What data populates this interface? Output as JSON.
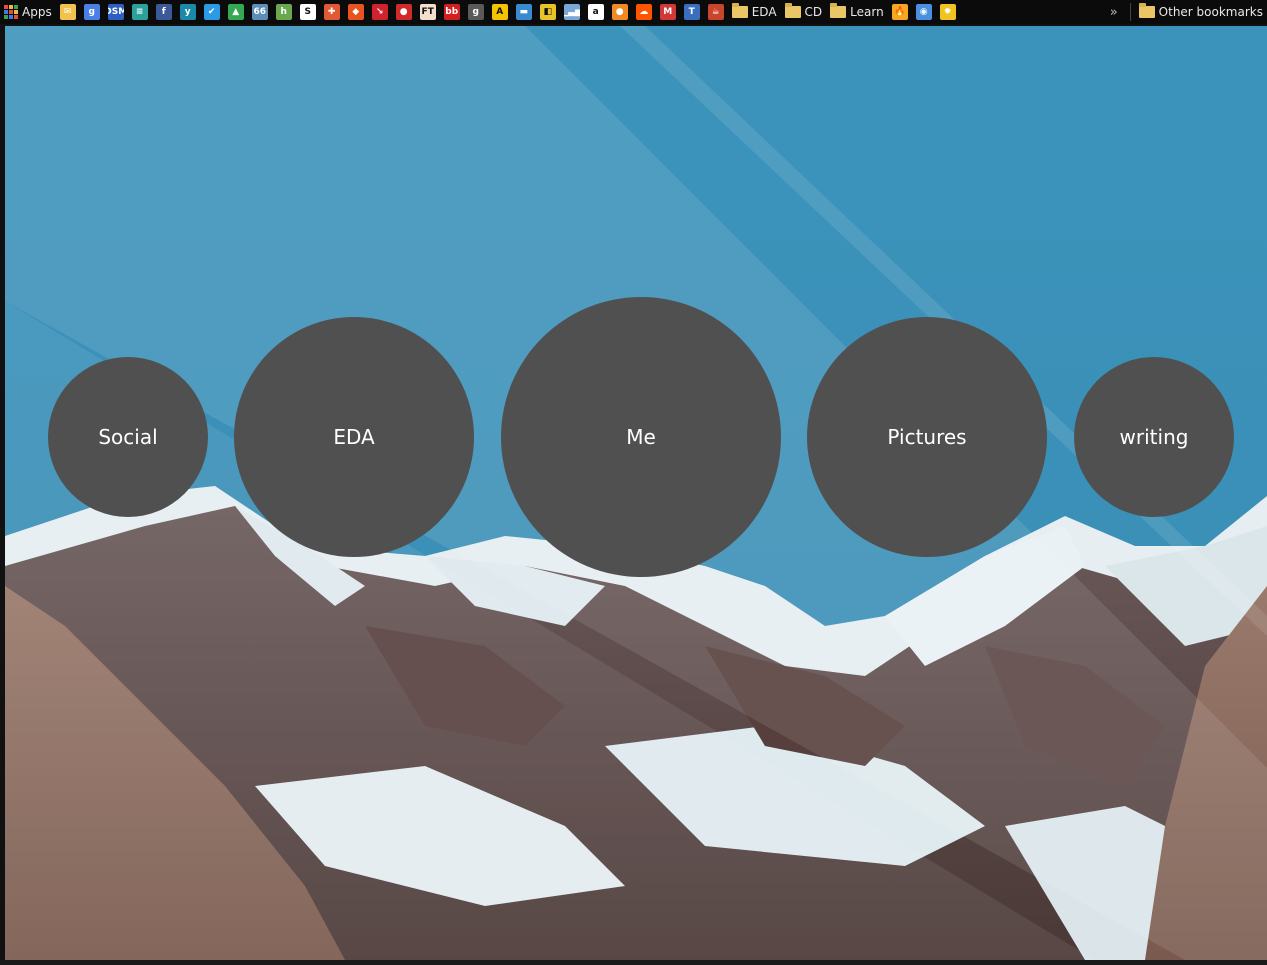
{
  "bookmarks_bar": {
    "apps_label": "Apps",
    "icons": [
      {
        "name": "checkmail-icon",
        "color": "#f1c24d",
        "glyph": "✉"
      },
      {
        "name": "google-icon",
        "color": "#4a7fe8",
        "glyph": "g"
      },
      {
        "name": "dsm-icon",
        "color": "#2f5fc0",
        "glyph": "DSM"
      },
      {
        "name": "translate-icon",
        "color": "#2aa29a",
        "glyph": "≡"
      },
      {
        "name": "facebook-icon",
        "color": "#3b5998",
        "glyph": "f"
      },
      {
        "name": "yc-icon",
        "color": "#1a8aa8",
        "glyph": "y"
      },
      {
        "name": "check-circle-icon",
        "color": "#2b9be8",
        "glyph": "✔"
      },
      {
        "name": "google-drive-icon",
        "color": "#34a853",
        "glyph": "▲"
      },
      {
        "name": "sixty-six-icon",
        "color": "#5b8fb8",
        "glyph": "66"
      },
      {
        "name": "h-icon",
        "color": "#6aa84f",
        "glyph": "h"
      },
      {
        "name": "s-icon",
        "color": "#ffffff",
        "glyph": "S"
      },
      {
        "name": "figure-icon",
        "color": "#e05a36",
        "glyph": "✚"
      },
      {
        "name": "layers-icon",
        "color": "#e8531f",
        "glyph": "◆"
      },
      {
        "name": "arrow-icon",
        "color": "#d0232e",
        "glyph": "↘"
      },
      {
        "name": "red-dot-icon",
        "color": "#d02a2a",
        "glyph": "●"
      },
      {
        "name": "ft-icon",
        "color": "#f2dfce",
        "glyph": "FT"
      },
      {
        "name": "bb-icon",
        "color": "#d21f1f",
        "glyph": "bb"
      },
      {
        "name": "goodreads-icon",
        "color": "#5a5a5a",
        "glyph": "g"
      },
      {
        "name": "a-icon",
        "color": "#f4c400",
        "glyph": "A"
      },
      {
        "name": "bars-icon",
        "color": "#3a8ad0",
        "glyph": "▬"
      },
      {
        "name": "flag-icon",
        "color": "#e8c42a",
        "glyph": "◧"
      },
      {
        "name": "signal-icon",
        "color": "#7aa7d8",
        "glyph": "▁▃▅"
      },
      {
        "name": "amazon-icon",
        "color": "#ffffff",
        "glyph": "a"
      },
      {
        "name": "orange-circle-icon",
        "color": "#f08a24",
        "glyph": "●"
      },
      {
        "name": "soundcloud-icon",
        "color": "#ff5500",
        "glyph": "☁"
      },
      {
        "name": "m-icon",
        "color": "#d23838",
        "glyph": "M"
      },
      {
        "name": "t-icon",
        "color": "#3a6fc0",
        "glyph": "T"
      },
      {
        "name": "coffee-icon",
        "color": "#c8442a",
        "glyph": "☕"
      }
    ],
    "folders": [
      {
        "name": "folder-eda",
        "label": "EDA"
      },
      {
        "name": "folder-cd",
        "label": "CD"
      },
      {
        "name": "folder-learn",
        "label": "Learn"
      }
    ],
    "tail_icons": [
      {
        "name": "flame-icon",
        "color": "#f5a623",
        "glyph": "🔥"
      },
      {
        "name": "globe-icon",
        "color": "#4a90e2",
        "glyph": "◉"
      },
      {
        "name": "sun-icon",
        "color": "#f0c420",
        "glyph": "✹"
      }
    ],
    "overflow": "»",
    "other_bookmarks_label": "Other bookmarks"
  },
  "nav": {
    "social": "Social",
    "eda": "EDA",
    "me": "Me",
    "pictures": "Pictures",
    "writing": "writing"
  },
  "colors": {
    "circle": "#505050",
    "sky": "#3a8fb5"
  }
}
